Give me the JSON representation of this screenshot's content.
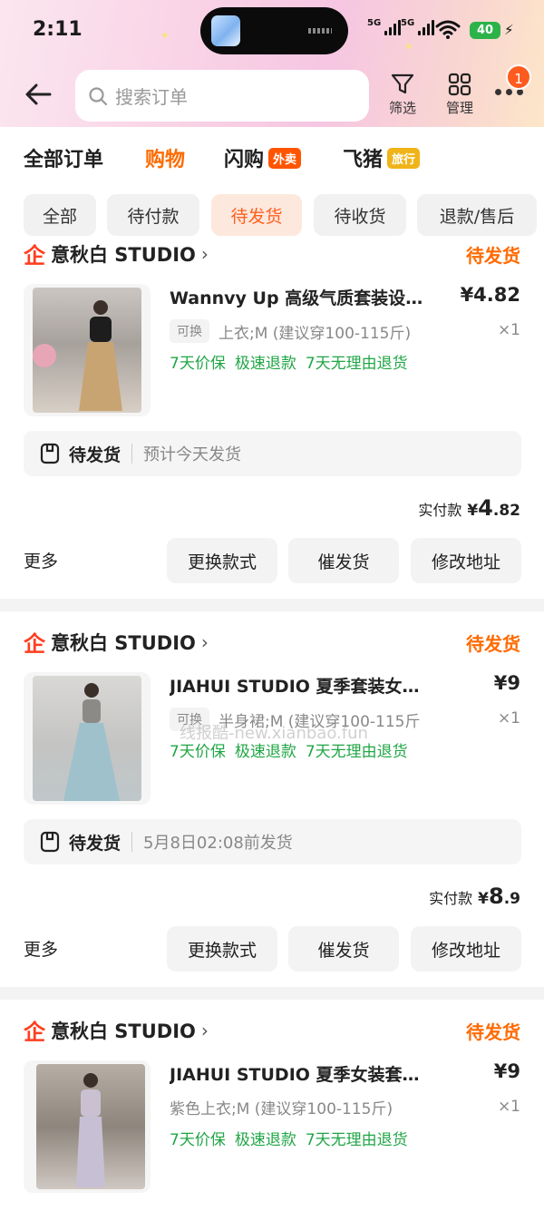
{
  "status_bar": {
    "time": "2:11",
    "net1": "5G",
    "net2": "5G",
    "battery": "40"
  },
  "search": {
    "placeholder": "搜索订单"
  },
  "header_actions": {
    "filter_label": "筛选",
    "manage_label": "管理",
    "notification_count": "1"
  },
  "main_tabs": [
    {
      "label": "全部订单",
      "tag": ""
    },
    {
      "label": "购物",
      "tag": ""
    },
    {
      "label": "闪购",
      "tag": "外卖"
    },
    {
      "label": "飞猪",
      "tag": "旅行"
    }
  ],
  "filter_chips": [
    "全部",
    "待付款",
    "待发货",
    "待收货",
    "退款/售后"
  ],
  "orders": [
    {
      "shop": "意秋白 STUDIO",
      "status": "待发货",
      "title": "Wannvy Up 高级气质套装设计感小众女装",
      "price": "¥4.82",
      "swap_tag": "可换",
      "sku": "上衣;M (建议穿100-115斤)",
      "qty": "×1",
      "guarantees": [
        "7天价保",
        "极速退款",
        "7天无理由退货"
      ],
      "ship_label": "待发货",
      "ship_eta": "预计今天发货",
      "paid_label": "实付款",
      "paid_currency": "¥",
      "paid_int": "4",
      "paid_dec": ".82",
      "more": "更多",
      "actions": [
        "更换款式",
        "催发货",
        "修改地址"
      ]
    },
    {
      "shop": "意秋白 STUDIO",
      "status": "待发货",
      "title": "JIAHUI STUDIO 夏季套装女设计感",
      "price": "¥9",
      "swap_tag": "可换",
      "sku": "半身裙;M (建议穿100-115斤",
      "qty": "×1",
      "guarantees": [
        "7天价保",
        "极速退款",
        "7天无理由退货"
      ],
      "ship_label": "待发货",
      "ship_eta": "5月8日02:08前发货",
      "paid_label": "实付款",
      "paid_currency": "¥",
      "paid_int": "8",
      "paid_dec": ".9",
      "more": "更多",
      "actions": [
        "更换款式",
        "催发货",
        "修改地址"
      ]
    },
    {
      "shop": "意秋白 STUDIO",
      "status": "待发货",
      "title": "JIAHUI STUDIO 夏季女装套装穿搭",
      "price": "¥9",
      "sku": "紫色上衣;M (建议穿100-115斤)",
      "qty": "×1",
      "guarantees": [
        "7天价保",
        "极速退款",
        "7天无理由退货"
      ]
    }
  ],
  "watermark": "线报酷-new.xianbao.fun",
  "colors": {
    "accent": "#ff6a00",
    "green": "#21a646",
    "logo_red": "#ff3e1f"
  }
}
